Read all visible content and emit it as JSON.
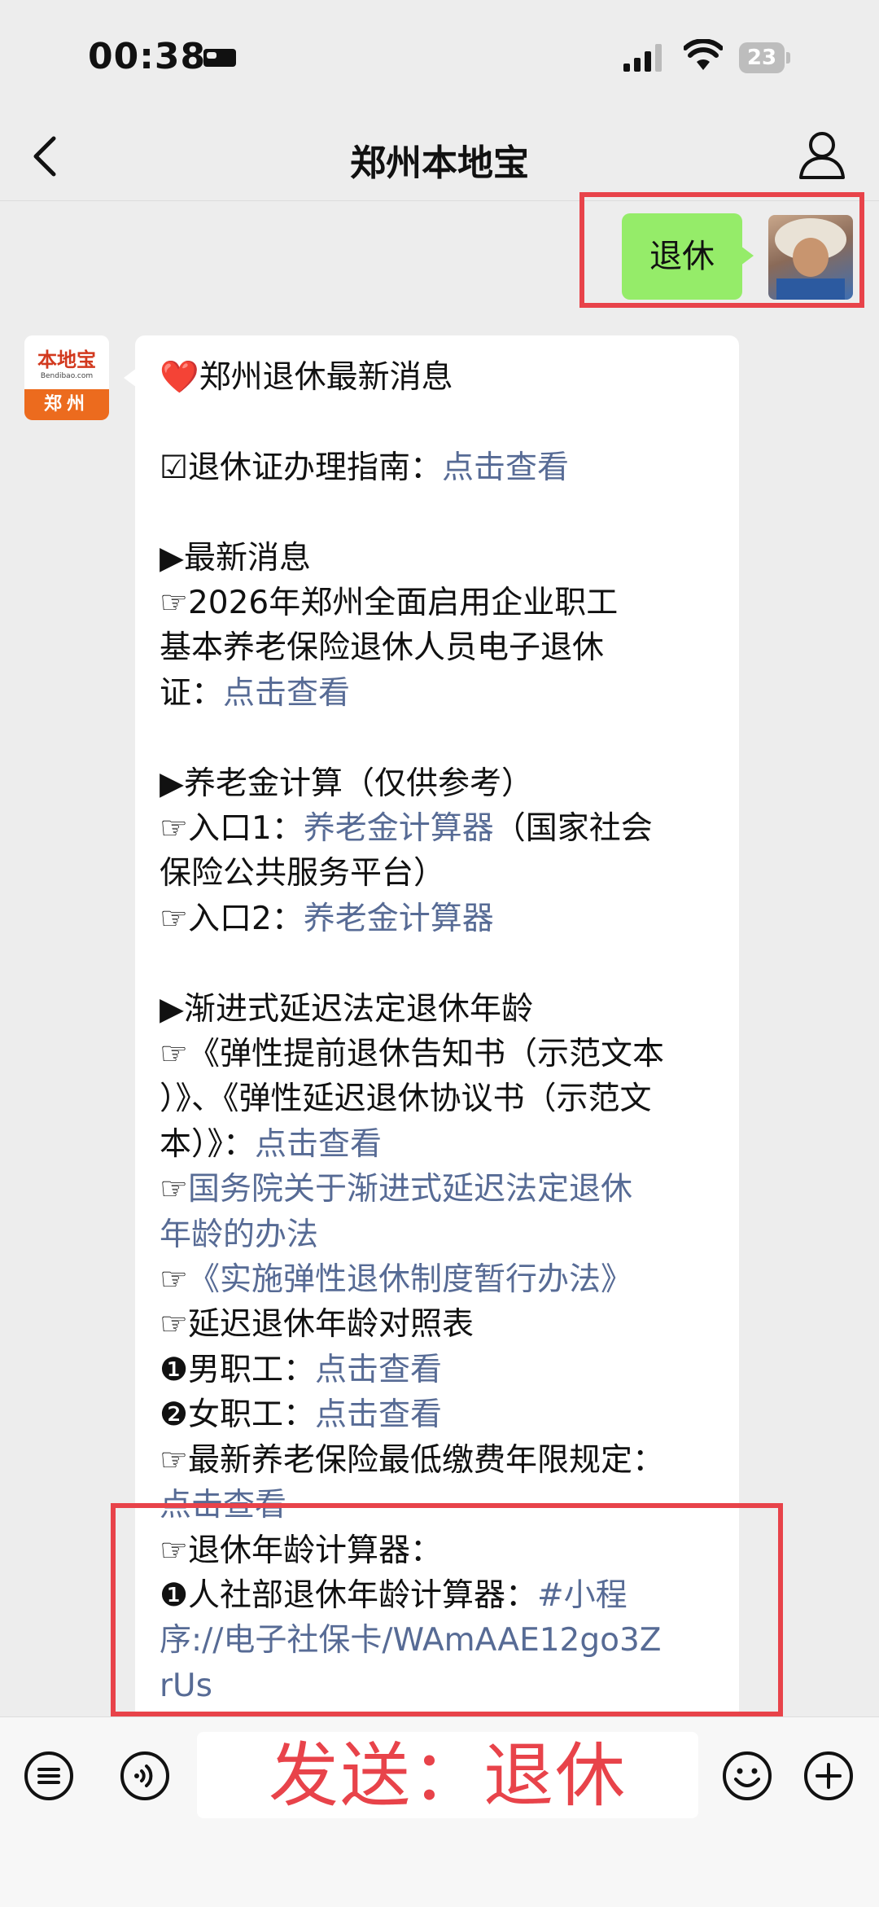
{
  "status_bar": {
    "time": "00:38",
    "battery": "23"
  },
  "nav": {
    "title": "郑州本地宝"
  },
  "sent_message": {
    "text": "退休"
  },
  "bot": {
    "avatar_logo": "本地宝",
    "avatar_url": "Bendibao.com",
    "avatar_city": "郑州"
  },
  "reply": {
    "heading": "郑州退休最新消息",
    "guide_label": "☑退休证办理指南：",
    "guide_link": "点击查看",
    "news_heading": "▶最新消息",
    "news_line1": "☞2026年郑州全面启用企业职工",
    "news_line2": "基本养老保险退休人员电子退休",
    "news_line3_prefix": "证：",
    "news_link": "点击查看",
    "pension_heading": "▶养老金计算（仅供参考）",
    "entry1_prefix": "☞入口1：",
    "entry1_link": "养老金计算器",
    "entry1_suffix": "（国家社会",
    "entry1_line2": "保险公共服务平台）",
    "entry2_prefix": "☞入口2：",
    "entry2_link": "养老金计算器",
    "delay_heading": "▶渐进式延迟法定退休年龄",
    "delay_line1": "☞《弹性提前退休告知书（示范文本",
    "delay_line2": "）》、《弹性延迟退休协议书（示范文",
    "delay_line3_prefix": "本）》：",
    "delay_link1": "点击查看",
    "state_prefix": "☞",
    "state_link_l1": "国务院关于渐进式延迟法定退休",
    "state_link_l2": "年龄的办法",
    "impl_prefix": "☞",
    "impl_link": "《实施弹性退休制度暂行办法》",
    "table_label": "☞延迟退休年龄对照表",
    "male_prefix": "❶男职工：",
    "male_link": "点击查看",
    "female_prefix": "❷女职工：",
    "female_link": "点击查看",
    "minyears_label": "☞最新养老保险最低缴费年限规定：",
    "minyears_link": "点击查看",
    "calc_label": "☞退休年龄计算器：",
    "calc1_prefix": "❶人社部退休年龄计算器：",
    "calc1_link_l1": "#小程",
    "calc1_link_l2": "序://电子社保卡/WAmAAE12go3Z",
    "calc1_link_l3": "rUs"
  },
  "input_bar": {
    "overlay_text": "发送：退休"
  },
  "icons": [
    "back-icon",
    "person-icon",
    "voice-list-icon",
    "voice-icon",
    "emoji-icon",
    "plus-icon"
  ],
  "colors": {
    "link": "#576b95",
    "sent_bubble": "#95ec69",
    "highlight": "#e8434a"
  }
}
